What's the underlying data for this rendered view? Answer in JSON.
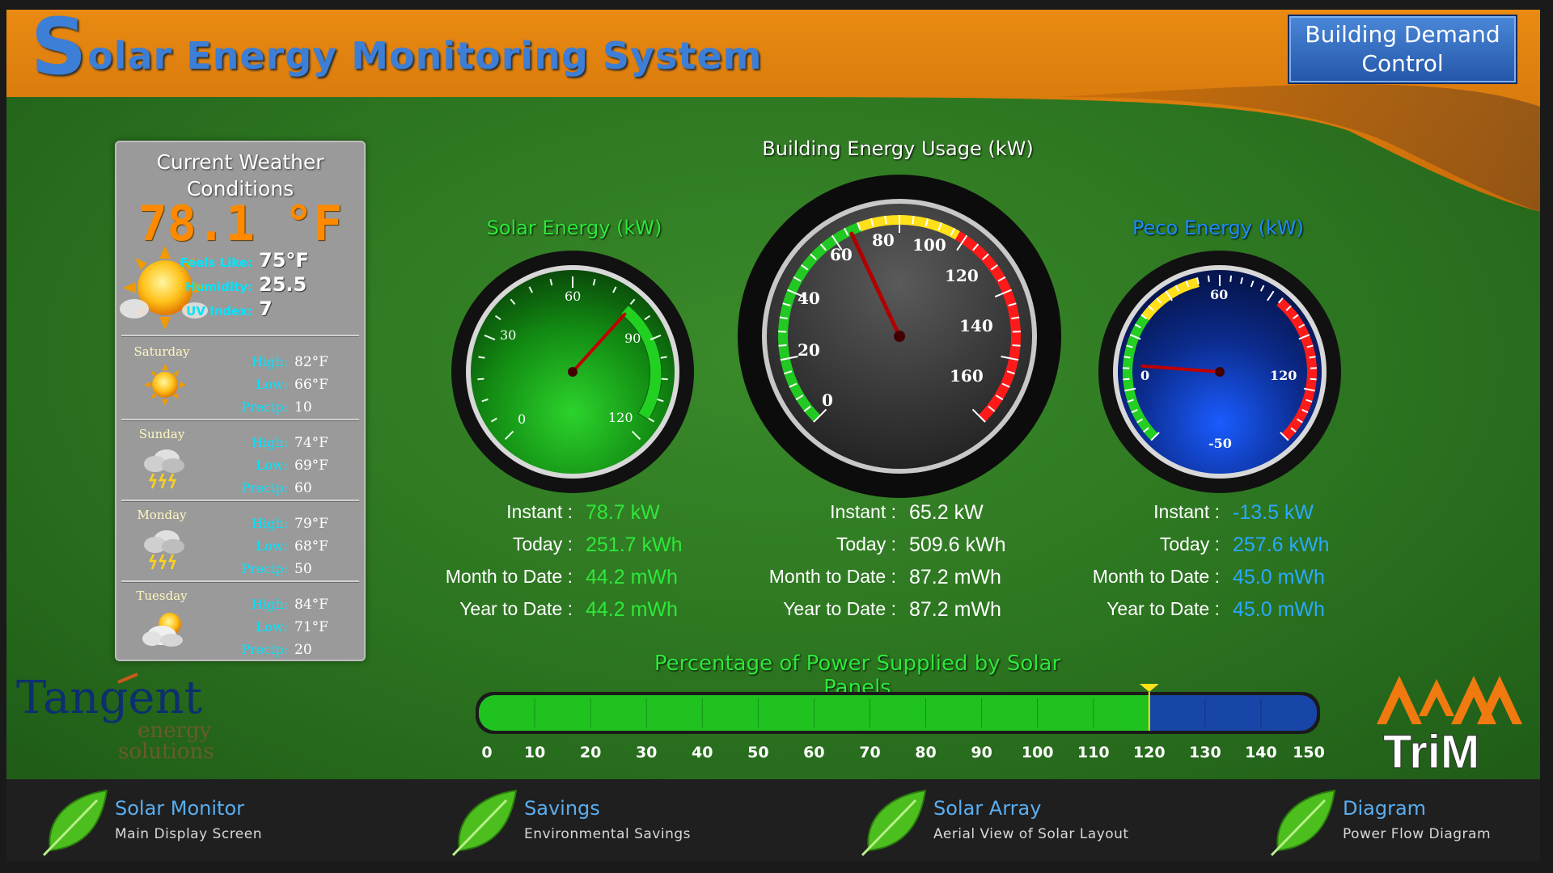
{
  "header": {
    "title_first": "S",
    "title_rest": "olar Energy Monitoring System",
    "demand_button": "Building Demand Control"
  },
  "weather": {
    "title": "Current Weather Conditions",
    "temperature": "78.1 °F",
    "feels_like_label": "Feels Like:",
    "feels_like_value": "75°F",
    "humidity_label": "Humidity:",
    "humidity_value": "25.5",
    "uv_label": "UV Index:",
    "uv_value": "7",
    "forecast": [
      {
        "day": "Saturday",
        "icon": "sunny-icon",
        "high_label": "High:",
        "high": "82°F",
        "low_label": "Low:",
        "low": "66°F",
        "precip_label": "Precip:",
        "precip": "10"
      },
      {
        "day": "Sunday",
        "icon": "thunderstorm-icon",
        "high_label": "High:",
        "high": "74°F",
        "low_label": "Low:",
        "low": "69°F",
        "precip_label": "Precip:",
        "precip": "60"
      },
      {
        "day": "Monday",
        "icon": "thunderstorm-icon",
        "high_label": "High:",
        "high": "79°F",
        "low_label": "Low:",
        "low": "68°F",
        "precip_label": "Precip:",
        "precip": "50"
      },
      {
        "day": "Tuesday",
        "icon": "partly-cloudy-icon",
        "high_label": "High:",
        "high": "84°F",
        "low_label": "Low:",
        "low": "71°F",
        "precip_label": "Precip:",
        "precip": "20"
      }
    ]
  },
  "gauges": {
    "title": "Building Energy Usage (kW)",
    "solar": {
      "title": "Solar Energy (kW)",
      "ticks": [
        "0",
        "30",
        "60",
        "90",
        "120"
      ],
      "reading": 78.7,
      "instant_label": "Instant :",
      "instant": "78.7 kW",
      "today_label": "Today :",
      "today": "251.7 kWh",
      "month_label": "Month to Date :",
      "month": "44.2 mWh",
      "year_label": "Year to Date :",
      "year": "44.2 mWh"
    },
    "building": {
      "ticks": [
        "0",
        "20",
        "40",
        "60",
        "80",
        "100",
        "120",
        "140",
        "160"
      ],
      "reading": 65.2,
      "instant_label": "Instant :",
      "instant": "65.2 kW",
      "today_label": "Today :",
      "today": "509.6 kWh",
      "month_label": "Month to Date :",
      "month": "87.2 mWh",
      "year_label": "Year to Date :",
      "year": "87.2 mWh"
    },
    "peco": {
      "title": "Peco Energy (kW)",
      "ticks": [
        "-50",
        "0",
        "60",
        "120"
      ],
      "reading": -13.5,
      "instant_label": "Instant :",
      "instant": "-13.5 kW",
      "today_label": "Today :",
      "today": "257.6 kWh",
      "month_label": "Month to Date :",
      "month": "45.0 mWh",
      "year_label": "Year to Date :",
      "year": "45.0 mWh"
    }
  },
  "solar_percentage": {
    "title": "Percentage of Power Supplied by Solar Panels",
    "value": 120,
    "max": 150,
    "ticks": [
      "0",
      "10",
      "20",
      "30",
      "40",
      "50",
      "60",
      "70",
      "80",
      "90",
      "100",
      "110",
      "120",
      "130",
      "140",
      "150"
    ]
  },
  "logos": {
    "tangent_main": "Tangent",
    "tangent_sub1": "energy",
    "tangent_sub2": "solutions",
    "trim": "TriM"
  },
  "nav": [
    {
      "title": "Solar Monitor",
      "subtitle": "Main Display Screen"
    },
    {
      "title": "Savings",
      "subtitle": "Environmental Savings"
    },
    {
      "title": "Solar Array",
      "subtitle": "Aerial View of Solar Layout"
    },
    {
      "title": "Diagram",
      "subtitle": "Power Flow Diagram"
    }
  ],
  "colors": {
    "accent_orange": "#ff8a00",
    "solar_green": "#2ee83a",
    "peco_blue": "#29a9ff",
    "header_orange": "#d97a10"
  }
}
